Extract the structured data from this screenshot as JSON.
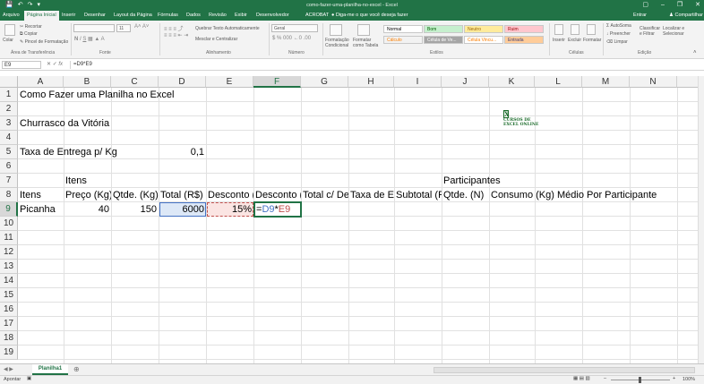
{
  "window": {
    "title": "como-fazer-uma-planilha-no-excel - Excel",
    "qat_icons": [
      "save-icon",
      "undo-icon",
      "redo-icon",
      "customize-icon"
    ],
    "controls": [
      "minimize-icon",
      "restore-icon",
      "close-icon"
    ]
  },
  "tabs": [
    "Arquivo",
    "Página Inicial",
    "Inserir",
    "Desenhar",
    "Layout da Página",
    "Fórmulas",
    "Dados",
    "Revisão",
    "Exibir",
    "Desenvolvedor",
    "ACROBAT",
    "Diga-me o que você deseja fazer",
    "Entrar",
    "Compartilhar"
  ],
  "ribbon": {
    "clipboard": {
      "paste": "Colar",
      "cut": "Recortar",
      "copy": "Copiar",
      "format_painter": "Pincel de Formatação",
      "label": "Área de Transferência"
    },
    "font": {
      "name": "",
      "size": "11",
      "label": "Fonte"
    },
    "alignment": {
      "wrap": "Quebrar Texto Automaticamente",
      "merge": "Mesclar e Centralizar",
      "label": "Alinhamento"
    },
    "number": {
      "format": "Geral",
      "label": "Número"
    },
    "styles": {
      "conditional": "Formatação Condicional",
      "table": "Formatar como Tabela",
      "boxes": [
        "Normal",
        "Bom",
        "Neutro",
        "Ruim",
        "Cálculo",
        "Célula de Ve...",
        "Célula Vincu...",
        "Entrada"
      ],
      "label": "Estilos"
    },
    "cells": {
      "insert": "Inserir",
      "delete": "Excluir",
      "format": "Formatar",
      "label": "Células"
    },
    "editing": {
      "autosum": "AutoSoma",
      "fill": "Preencher",
      "clear": "Limpar",
      "sort": "Classificar e Filtrar",
      "find": "Localizar e Selecionar",
      "label": "Edição"
    }
  },
  "formula_bar": {
    "name_box": "E9",
    "fx": "fx",
    "formula": "=D9*E9"
  },
  "columns": [
    "A",
    "B",
    "C",
    "D",
    "E",
    "F",
    "G",
    "H",
    "I",
    "J",
    "K",
    "L",
    "M",
    "N"
  ],
  "rows": [
    "1",
    "2",
    "3",
    "4",
    "5",
    "6",
    "7",
    "8",
    "9",
    "10",
    "11",
    "12",
    "13",
    "14",
    "15",
    "16",
    "17",
    "18",
    "19"
  ],
  "cells": {
    "A1": "Como Fazer uma Planilha no Excel",
    "A3": "Churrasco da Vitória",
    "A5": "Taxa de Entrega p/ Kg",
    "D5": "0,1",
    "B7": "Itens",
    "J7": "Participantes",
    "A8": "Itens",
    "B8": "Preço (Kg)",
    "C8": "Qtde. (Kg)",
    "D8": "Total (R$)",
    "E8": "Desconto (",
    "F8": "Desconto (",
    "G8": "Total c/ De",
    "H8": "Taxa de En",
    "I8": "Subtotal (R",
    "J8": "Qtde. (N)",
    "K8": "Consumo (Kg) Médio Por Participante",
    "A9": "Picanha",
    "B9": "40",
    "C9": "150",
    "D9": "6000",
    "E9": "15%",
    "F9_ref1": "D9",
    "F9_op": "*",
    "F9_ref2": "E9",
    "F9_eq": "="
  },
  "logo": {
    "line1": "CURSOS DE",
    "line2": "EXCEL ONLINE"
  },
  "sheet_tabs": [
    "Planilha1"
  ],
  "status": {
    "mode": "Apontar",
    "zoom": "100%"
  },
  "colors": {
    "excel_green": "#217346",
    "ref_blue": "#4472c4",
    "ref_red": "#c0504d"
  }
}
